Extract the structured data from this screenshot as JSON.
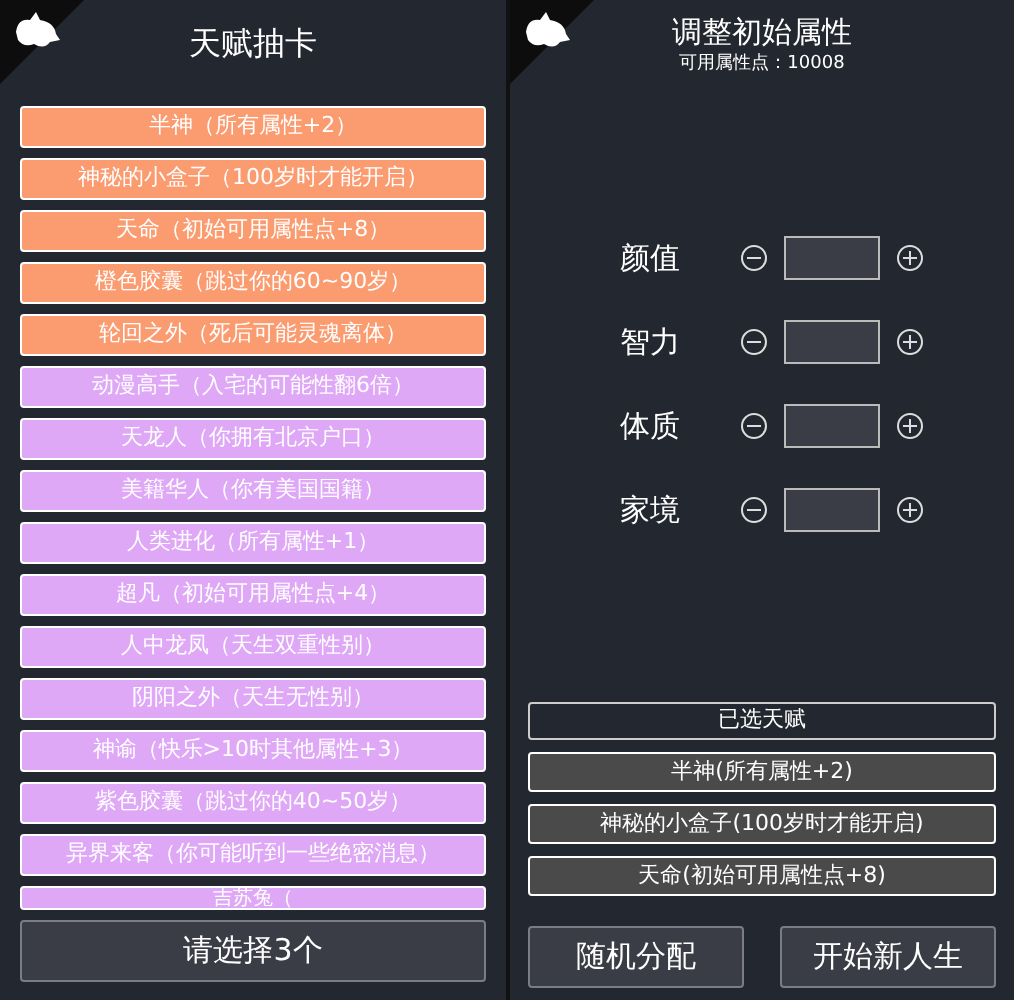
{
  "talent_screen": {
    "title": "天赋抽卡",
    "cards": [
      {
        "text": "半神（所有属性+2）",
        "color": "#fb9b70"
      },
      {
        "text": "神秘的小盒子（100岁时才能开启）",
        "color": "#fb9b70"
      },
      {
        "text": "天命（初始可用属性点+8）",
        "color": "#fb9b70"
      },
      {
        "text": "橙色胶囊（跳过你的60~90岁）",
        "color": "#fb9b70"
      },
      {
        "text": "轮回之外（死后可能灵魂离体）",
        "color": "#fb9b70"
      },
      {
        "text": "动漫高手（入宅的可能性翻6倍）",
        "color": "#dfa8f7"
      },
      {
        "text": "天龙人（你拥有北京户口）",
        "color": "#dfa8f7"
      },
      {
        "text": "美籍华人（你有美国国籍）",
        "color": "#dfa8f7"
      },
      {
        "text": "人类进化（所有属性+1）",
        "color": "#dfa8f7"
      },
      {
        "text": "超凡（初始可用属性点+4）",
        "color": "#dfa8f7"
      },
      {
        "text": "人中龙凤（天生双重性别）",
        "color": "#dfa8f7"
      },
      {
        "text": "阴阳之外（天生无性别）",
        "color": "#dfa8f7"
      },
      {
        "text": "神谕（快乐>10时其他属性+3）",
        "color": "#dfa8f7"
      },
      {
        "text": "紫色胶囊（跳过你的40~50岁）",
        "color": "#dfa8f7"
      },
      {
        "text": "异界来客（你可能听到一些绝密消息）",
        "color": "#dfa8f7"
      },
      {
        "text": "吉苏兔（",
        "color": "#dfa8f7",
        "cut": true
      }
    ],
    "button": "请选择3个"
  },
  "attribute_screen": {
    "title": "调整初始属性",
    "points_label": "可用属性点：",
    "points": "10008",
    "attributes": [
      {
        "label": "颜值"
      },
      {
        "label": "智力"
      },
      {
        "label": "体质"
      },
      {
        "label": "家境"
      }
    ],
    "selected_header": "已选天赋",
    "selected_talents": [
      "半神(所有属性+2)",
      "神秘的小盒子(100岁时才能开启)",
      "天命(初始可用属性点+8)"
    ],
    "buttons": [
      "随机分配",
      "开始新人生"
    ]
  }
}
